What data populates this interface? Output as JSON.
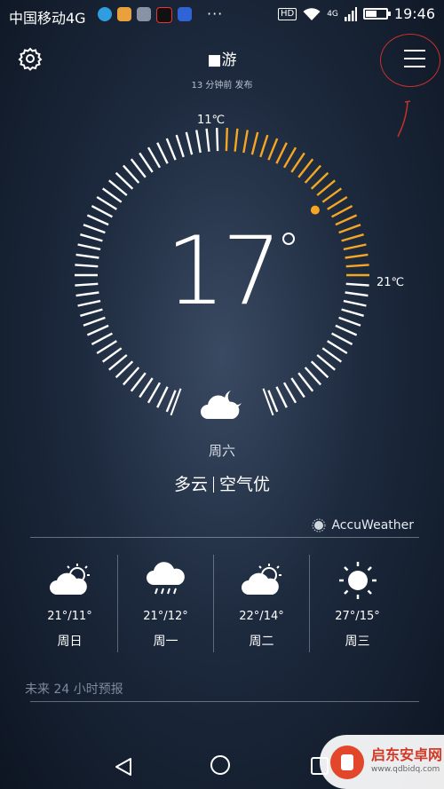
{
  "status_bar": {
    "carrier": "中国移动4G",
    "more": "···",
    "hd": "HD",
    "network": "4G",
    "battery_level": 0.5,
    "time": "19:46"
  },
  "header": {
    "city": "■游",
    "published": "13 分钟前 发布"
  },
  "dial": {
    "current_temp": "17",
    "min_label": "11℃",
    "max_label": "21℃",
    "accent_color": "#f5a623"
  },
  "today": {
    "weekday": "周六",
    "condition": "多云",
    "air": "空气优",
    "icon": "cloudy-night-icon"
  },
  "provider": "AccuWeather",
  "forecast": [
    {
      "range": "21°/11°",
      "day": "周日",
      "icon": "partly-cloudy-icon"
    },
    {
      "range": "21°/12°",
      "day": "周一",
      "icon": "rain-icon"
    },
    {
      "range": "22°/14°",
      "day": "周二",
      "icon": "partly-cloudy-icon"
    },
    {
      "range": "27°/15°",
      "day": "周三",
      "icon": "sun-icon"
    }
  ],
  "next_24h_label": "未来 24 小时预报",
  "watermark": {
    "title": "启东安卓网",
    "url": "www.qdbidq.com"
  }
}
